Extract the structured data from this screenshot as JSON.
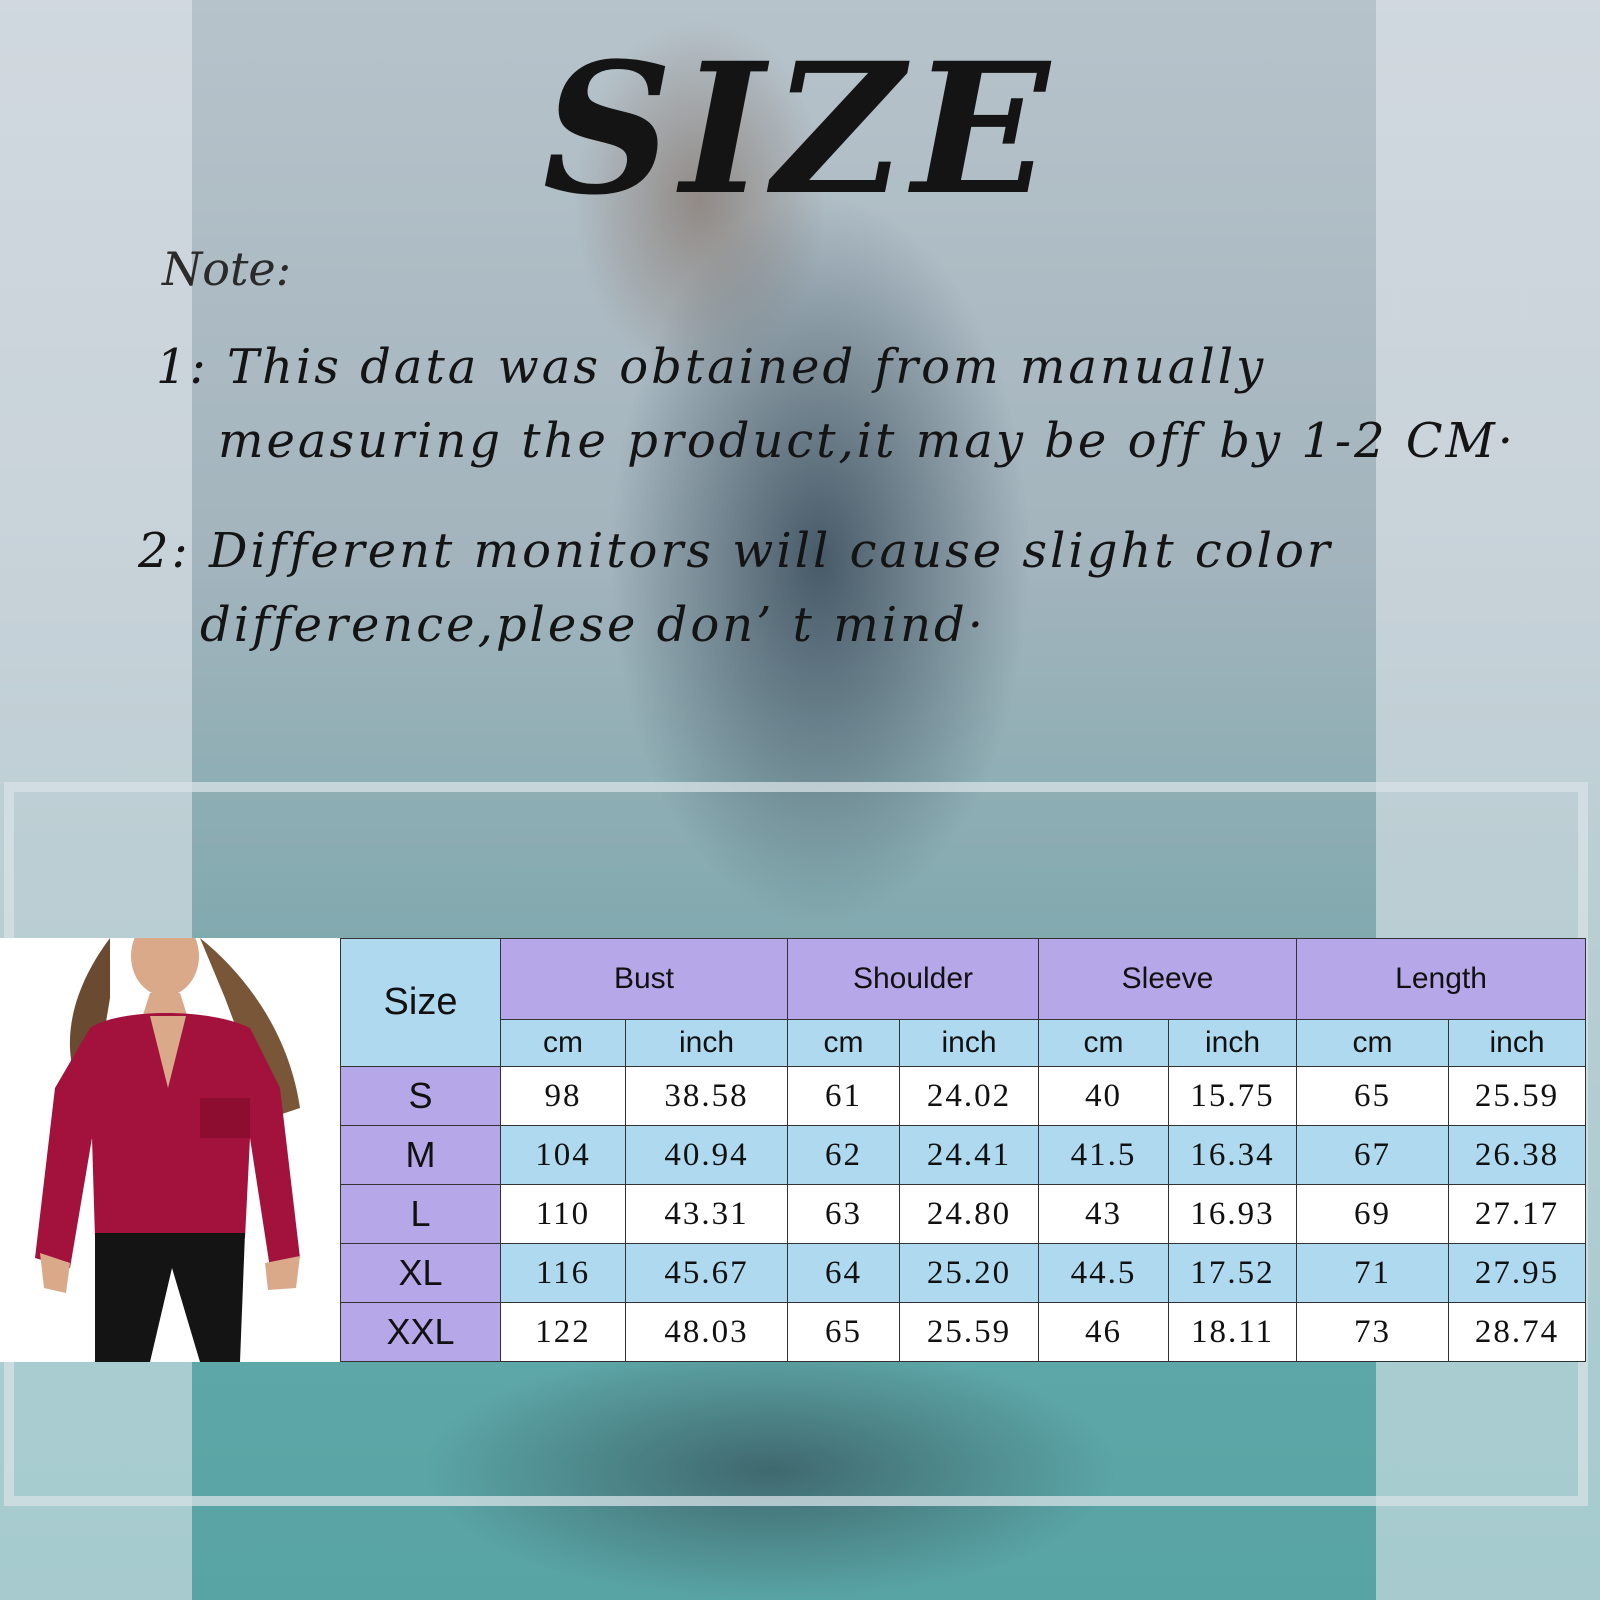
{
  "title": "SIZE",
  "note_label": "Note:",
  "notes": [
    {
      "line1": "1: This data was obtained from manually",
      "line2": "measuring the product,it may be off by 1-2 CM·"
    },
    {
      "line1": "2: Different monitors will cause slight color",
      "line2": "difference,plese don’ t mind·"
    }
  ],
  "table": {
    "size_header": "Size",
    "groups": [
      "Bust",
      "Shoulder",
      "Sleeve",
      "Length"
    ],
    "units": [
      "cm",
      "inch",
      "cm",
      "inch",
      "cm",
      "inch",
      "cm",
      "inch"
    ],
    "rows": [
      {
        "size": "S",
        "values": [
          "98",
          "38.58",
          "61",
          "24.02",
          "40",
          "15.75",
          "65",
          "25.59"
        ]
      },
      {
        "size": "M",
        "values": [
          "104",
          "40.94",
          "62",
          "24.41",
          "41.5",
          "16.34",
          "67",
          "26.38"
        ]
      },
      {
        "size": "L",
        "values": [
          "110",
          "43.31",
          "63",
          "24.80",
          "43",
          "16.93",
          "69",
          "27.17"
        ]
      },
      {
        "size": "XL",
        "values": [
          "116",
          "45.67",
          "64",
          "25.20",
          "44.5",
          "17.52",
          "71",
          "27.95"
        ]
      },
      {
        "size": "XXL",
        "values": [
          "122",
          "48.03",
          "65",
          "25.59",
          "46",
          "18.11",
          "73",
          "28.74"
        ]
      }
    ]
  },
  "colors": {
    "header_purple": "#b6a8e8",
    "header_blue": "#aed9ee",
    "shirt_red": "#a3123c"
  }
}
